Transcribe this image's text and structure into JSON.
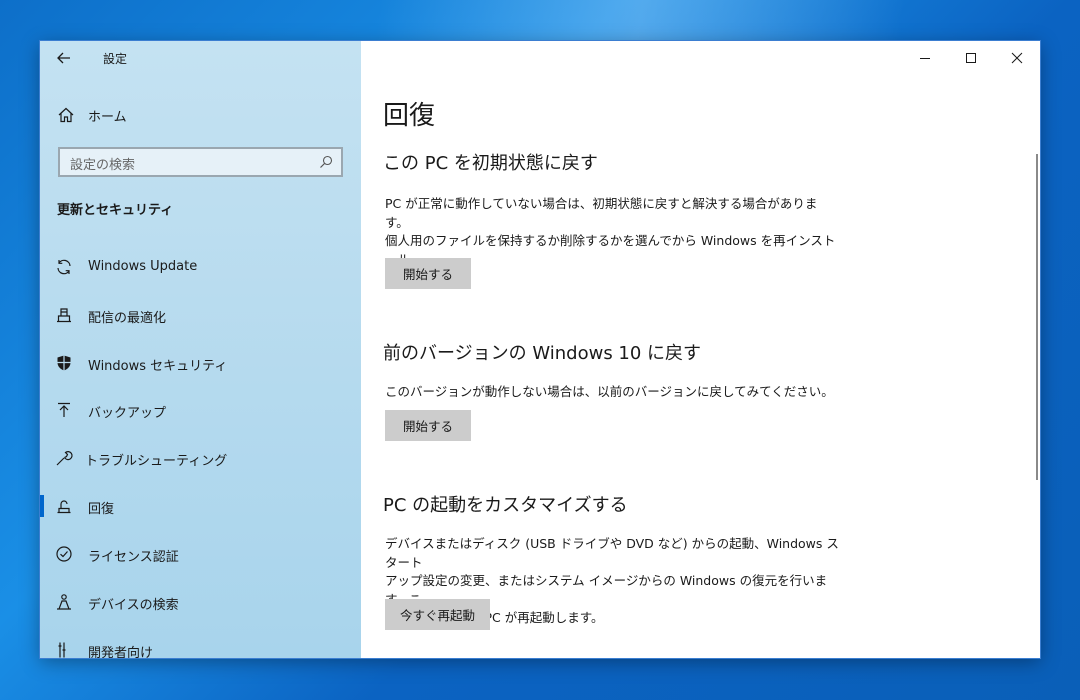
{
  "window": {
    "app_title": "設定",
    "controls": {
      "minimize": "minimize",
      "maximize": "maximize",
      "close": "close"
    }
  },
  "sidebar": {
    "home_label": "ホーム",
    "search_placeholder": "設定の検索",
    "section_title": "更新とセキュリティ",
    "items": [
      {
        "label": "Windows Update",
        "icon": "sync-icon",
        "active": false
      },
      {
        "label": "配信の最適化",
        "icon": "delivery-optimization-icon",
        "active": false
      },
      {
        "label": "Windows セキュリティ",
        "icon": "shield-icon",
        "active": false
      },
      {
        "label": "バックアップ",
        "icon": "upload-arrow-icon",
        "active": false
      },
      {
        "label": "トラブルシューティング",
        "icon": "wrench-icon",
        "active": false
      },
      {
        "label": "回復",
        "icon": "recovery-icon",
        "active": true
      },
      {
        "label": "ライセンス認証",
        "icon": "check-circle-icon",
        "active": false
      },
      {
        "label": "デバイスの検索",
        "icon": "person-locate-icon",
        "active": false
      },
      {
        "label": "開発者向け",
        "icon": "developer-tools-icon",
        "active": false
      }
    ]
  },
  "main": {
    "page_title": "回復",
    "sections": [
      {
        "heading": "この PC を初期状態に戻す",
        "lines": [
          "PC が正常に動作していない場合は、初期状態に戻すと解決する場合があります。",
          "個人用のファイルを保持するか削除するかを選んでから Windows を再インストール",
          "できます。"
        ],
        "button": "開始する"
      },
      {
        "heading": "前のバージョンの Windows 10 に戻す",
        "lines": [
          "このバージョンが動作しない場合は、以前のバージョンに戻してみてください。"
        ],
        "button": "開始する"
      },
      {
        "heading": "PC の起動をカスタマイズする",
        "lines": [
          "デバイスまたはディスク (USB ドライブや DVD など) からの起動、Windows スタート",
          "アップ設定の変更、またはシステム イメージからの Windows の復元を行います。こ",
          "の操作を行うと、PC が再起動します。"
        ],
        "button": "今すぐ再起動"
      }
    ]
  },
  "colors": {
    "accent": "#0066cc",
    "sidebar_bg": "#b9dcef",
    "button_bg": "#cccccc",
    "desktop_bg": "#0d6fc9"
  }
}
